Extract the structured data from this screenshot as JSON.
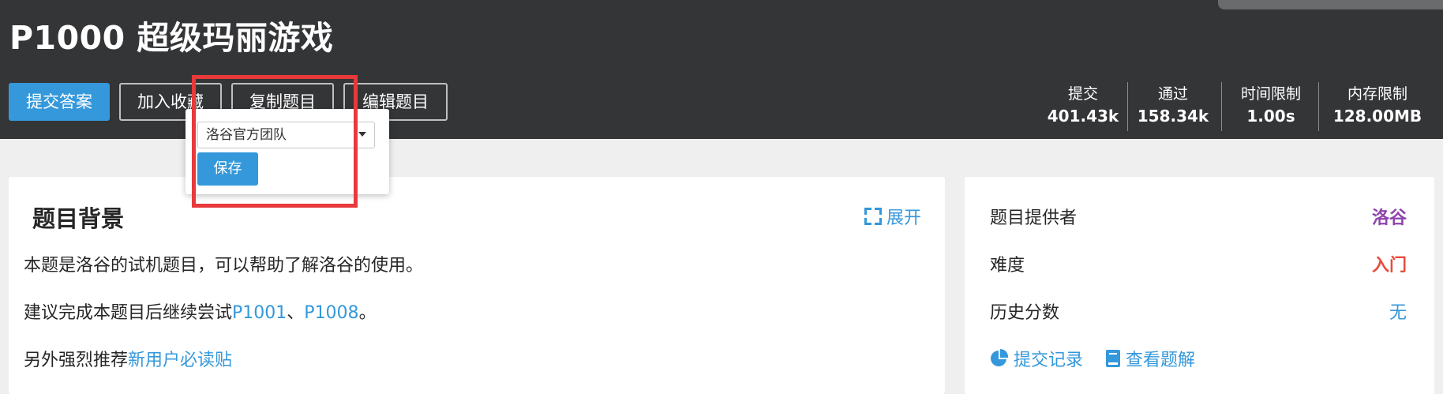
{
  "problem": {
    "title": "P1000 超级玛丽游戏"
  },
  "actions": {
    "submit_label": "提交答案",
    "favorite_label": "加入收藏",
    "copy_label": "复制题目",
    "edit_label": "编辑题目"
  },
  "stats": [
    {
      "label": "提交",
      "value": "401.43k"
    },
    {
      "label": "通过",
      "value": "158.34k"
    },
    {
      "label": "时间限制",
      "value": "1.00s"
    },
    {
      "label": "内存限制",
      "value": "128.00MB"
    }
  ],
  "copy_popover": {
    "selected_team": "洛谷官方团队",
    "save_label": "保存"
  },
  "background": {
    "heading": "题目背景",
    "expand_label": "展开",
    "line1": "本题是洛谷的试机题目，可以帮助了解洛谷的使用。",
    "line2_prefix": "建议完成本题目后继续尝试",
    "link_p1001": "P1001",
    "separator": "、",
    "link_p1008": "P1008",
    "line2_suffix": "。",
    "line3_prefix": "另外强烈推荐",
    "link_newbie": "新用户必读贴"
  },
  "info": {
    "provider_label": "题目提供者",
    "provider_value": "洛谷",
    "difficulty_label": "难度",
    "difficulty_value": "入门",
    "history_label": "历史分数",
    "history_value": "无",
    "submissions_link": "提交记录",
    "solutions_link": "查看题解"
  },
  "colors": {
    "header_bg": "#343537",
    "accent": "#3498db",
    "provider": "#8e44ad",
    "difficulty": "#e74c3c",
    "highlight": "#e8393b"
  },
  "icons": {
    "expand": "expand-icon",
    "submissions": "pie-chart-icon",
    "solutions": "book-icon",
    "select_caret": "chevron-down-icon"
  }
}
